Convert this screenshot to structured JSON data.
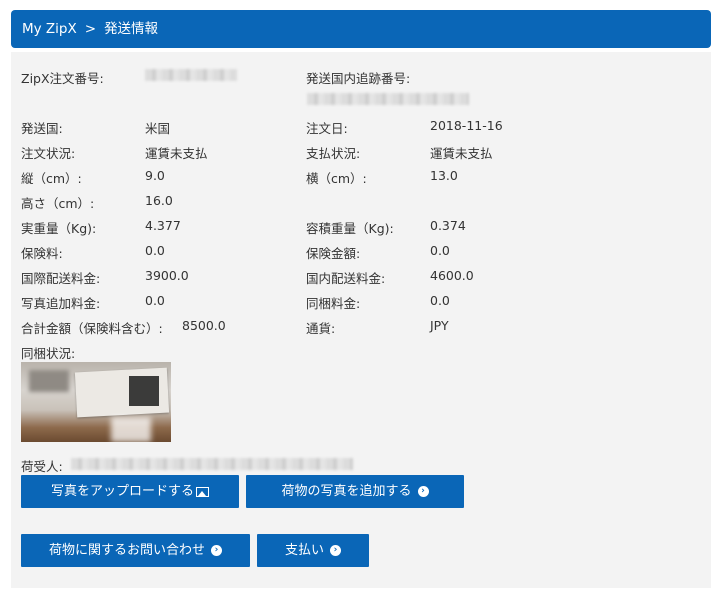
{
  "breadcrumb": {
    "home": "My ZipX",
    "separator": ">",
    "current": "発送情報"
  },
  "order_no_label": "ZipX注文番号:",
  "domestic_tracking_label": "発送国内追跡番号:",
  "rows": [
    {
      "l1": "発送国:",
      "v1": "米国",
      "l2": "注文日:",
      "v2": "2018-11-16"
    },
    {
      "l1": "注文状況:",
      "v1": "運賃未支払",
      "l2": "支払状況:",
      "v2": "運賃未支払"
    },
    {
      "l1": "縦（cm）:",
      "v1": "9.0",
      "l2": "横（cm）:",
      "v2": "13.0"
    },
    {
      "l1": "高さ（cm）:",
      "v1": "16.0",
      "l2": "",
      "v2": ""
    },
    {
      "l1": "実重量（Kg):",
      "v1": "4.377",
      "l2": "容積重量（Kg):",
      "v2": "0.374"
    },
    {
      "l1": "保険料:",
      "v1": "0.0",
      "l2": "保険金額:",
      "v2": "0.0"
    },
    {
      "l1": "国際配送料金:",
      "v1": "3900.0",
      "l2": "国内配送料金:",
      "v2": "4600.0"
    },
    {
      "l1": "写真追加料金:",
      "v1": "0.0",
      "l2": "同梱料金:",
      "v2": "0.0"
    },
    {
      "l1": "合計金額（保険料含む）:",
      "v1": "8500.0",
      "l2": "通貨:",
      "v2": "JPY"
    }
  ],
  "bundle_status_label": "同梱状況:",
  "recipient_label": "荷受人:",
  "buttons": {
    "upload_photo": "写真をアップロードする",
    "add_photo": "荷物の写真を追加する",
    "inquiry": "荷物に関するお問い合わせ",
    "pay": "支払い"
  },
  "colors": {
    "primary": "#0a66b7",
    "panel": "#f3f3f3"
  },
  "icons": {
    "image": "image-icon",
    "arrow": "circle-arrow-right-icon"
  }
}
